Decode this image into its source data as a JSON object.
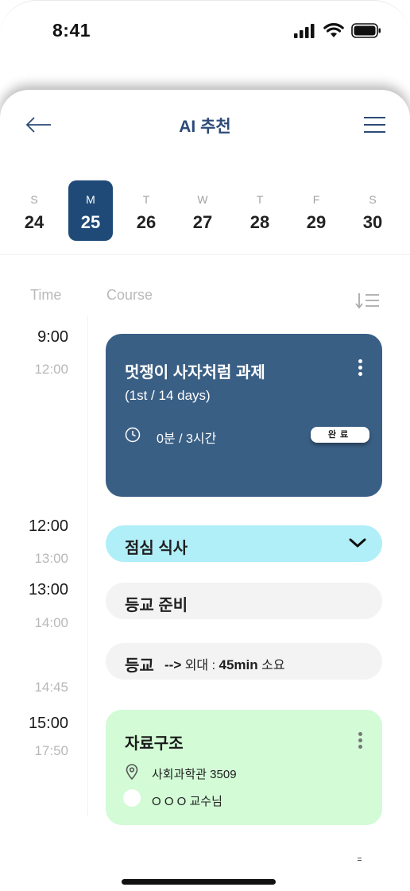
{
  "status_bar": {
    "time": "8:41"
  },
  "header": {
    "title": "AI 추천"
  },
  "week": [
    {
      "dow": "S",
      "date": "24",
      "selected": false
    },
    {
      "dow": "M",
      "date": "25",
      "selected": true
    },
    {
      "dow": "T",
      "date": "26",
      "selected": false
    },
    {
      "dow": "W",
      "date": "27",
      "selected": false
    },
    {
      "dow": "T",
      "date": "28",
      "selected": false
    },
    {
      "dow": "F",
      "date": "29",
      "selected": false
    },
    {
      "dow": "S",
      "date": "30",
      "selected": false
    }
  ],
  "columns": {
    "time": "Time",
    "course": "Course"
  },
  "schedule": {
    "task": {
      "start": "9:00",
      "end": "12:00",
      "title": "멋쟁이 사자처럼 과제",
      "subtitle": "(1st / 14 days)",
      "duration": "0분 / 3시간",
      "badge": "완료"
    },
    "lunch": {
      "start": "12:00",
      "end": "13:00",
      "title": "점심 식사"
    },
    "prep": {
      "start": "13:00",
      "end": "14:00",
      "title": "등교 준비"
    },
    "commute": {
      "end": "14:45",
      "title": "등교",
      "arrow": "-->",
      "destination": "외대 :",
      "time": "45min",
      "suffix": "소요"
    },
    "class": {
      "start": "15:00",
      "end": "17:50",
      "title": "자료구조",
      "location": "사회과학관 3509",
      "professor": "O O O 교수님"
    }
  },
  "colors": {
    "accent": "#1f4a78",
    "task_card": "#3a5f85",
    "lunch_pill": "#b0eef8",
    "class_card": "#d2fbd6",
    "title_text": "#2d4a78"
  },
  "icons": [
    "back-arrow-icon",
    "hamburger-menu-icon",
    "sort-icon",
    "clock-icon",
    "kebab-menu-icon",
    "chevron-down-icon",
    "location-pin-icon",
    "signal-icon",
    "wifi-icon",
    "battery-icon"
  ]
}
